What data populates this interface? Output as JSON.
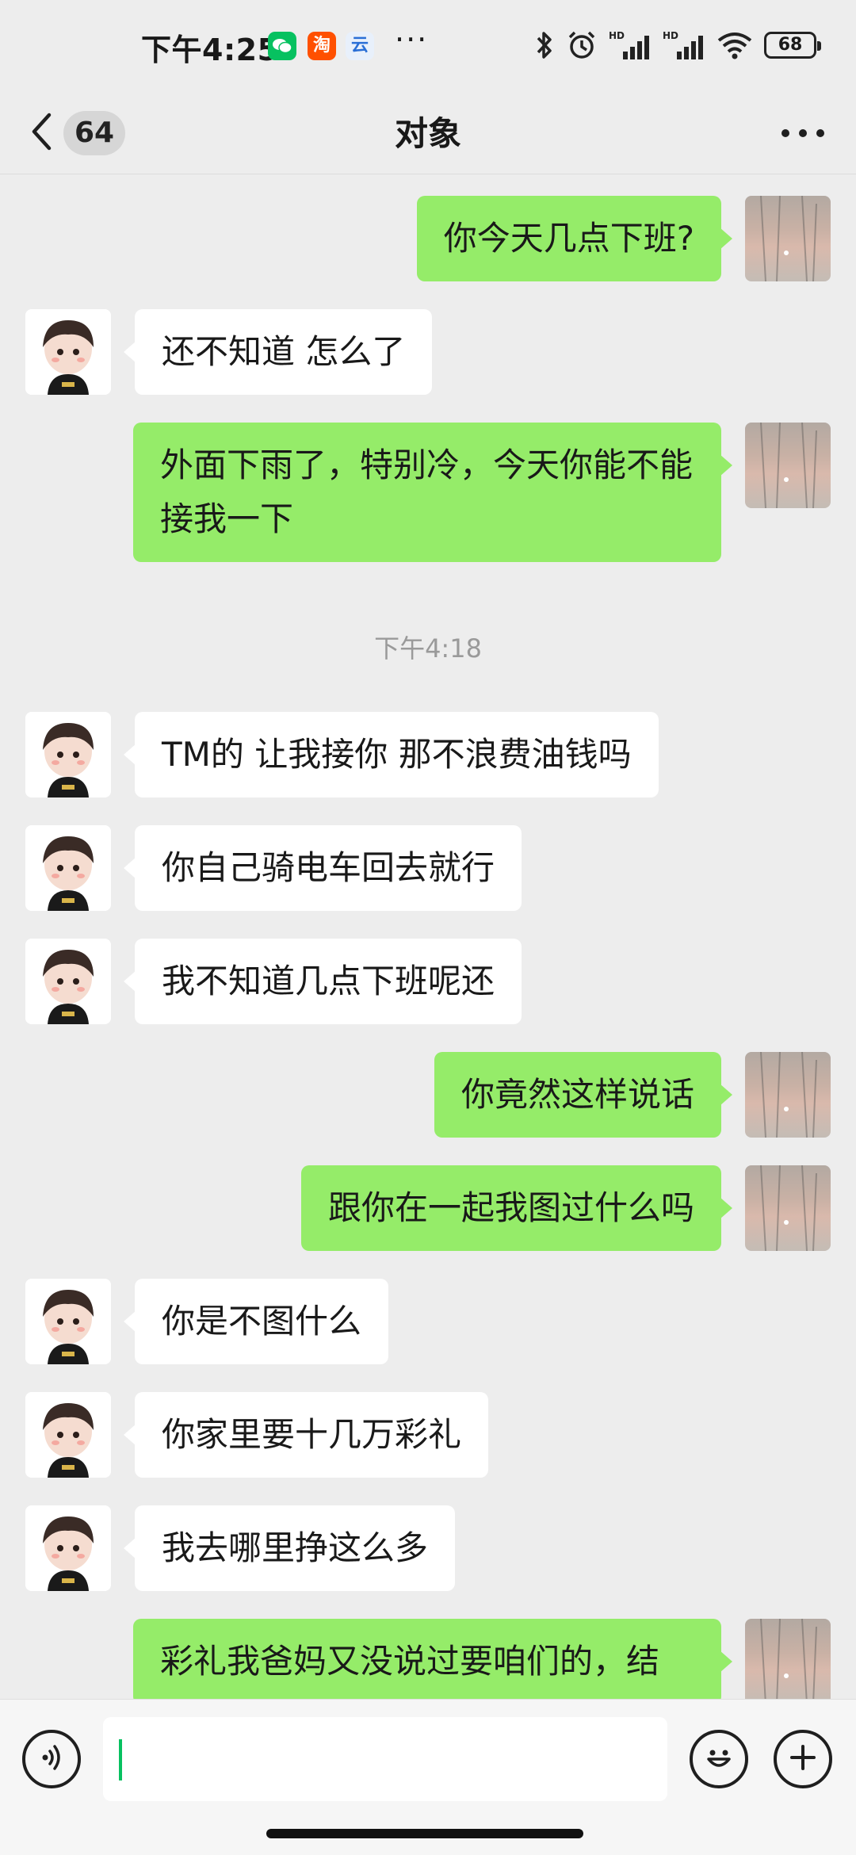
{
  "status_bar": {
    "time": "下午4:25",
    "apps": [
      {
        "name": "wechat",
        "color": "#07c160",
        "glyph": "✉"
      },
      {
        "name": "taobao",
        "color": "#ff5000",
        "glyph": "淘"
      },
      {
        "name": "cloud",
        "color": "#4a90e2",
        "glyph": "云"
      }
    ],
    "overflow": "···",
    "network_tag": "HD",
    "battery": "68"
  },
  "nav": {
    "unread_count": "64",
    "title": "对象"
  },
  "messages": [
    {
      "side": "right",
      "text": "你今天几点下班?"
    },
    {
      "side": "left",
      "text": "还不知道  怎么了"
    },
    {
      "side": "right",
      "text": "外面下雨了，特别冷，今天你能不能接我一下"
    },
    {
      "type": "time",
      "text": "下午4:18"
    },
    {
      "side": "left",
      "text": "TM的   让我接你  那不浪费油钱吗"
    },
    {
      "side": "left",
      "text": "你自己骑电车回去就行"
    },
    {
      "side": "left",
      "text": "我不知道几点下班呢还"
    },
    {
      "side": "right",
      "text": "你竟然这样说话"
    },
    {
      "side": "right",
      "text": "跟你在一起我图过什么吗"
    },
    {
      "side": "left",
      "text": "你是不图什么"
    },
    {
      "side": "left",
      "text": "你家里要十几万彩礼"
    },
    {
      "side": "left",
      "text": "我去哪里挣这么多"
    },
    {
      "side": "right",
      "text": "彩礼我爸妈又没说过要咱们的，结"
    }
  ],
  "colors": {
    "self_bubble": "#95ec69",
    "other_bubble": "#ffffff",
    "background": "#ededed",
    "cursor": "#07c160"
  },
  "icons": {
    "back": "chevron-left-icon",
    "more": "more-dots-icon",
    "voice": "voice-icon",
    "emoji": "emoji-icon",
    "plus": "plus-icon"
  }
}
